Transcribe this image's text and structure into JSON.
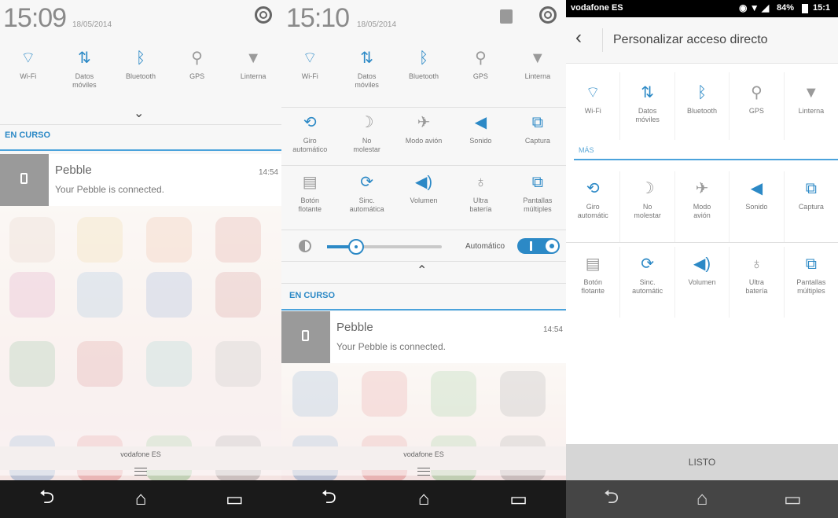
{
  "accent": "#2c89c6",
  "icons_map": {
    "wifi": "wifi-icon",
    "data": "mobile-data-icon",
    "bluetooth": "bluetooth-icon",
    "gps": "gps-icon",
    "torch": "flashlight-icon"
  },
  "screen1": {
    "time": "15:09",
    "date": "18/05/2014",
    "toggles": [
      {
        "label": "Wi-Fi",
        "icon": "wifi-icon"
      },
      {
        "label": "Datos\nmóviles",
        "icon": "mobile-data-icon"
      },
      {
        "label": "Bluetooth",
        "icon": "bluetooth-icon"
      },
      {
        "label": "GPS",
        "icon": "gps-icon"
      },
      {
        "label": "Linterna",
        "icon": "flashlight-icon"
      }
    ],
    "section": "EN CURSO",
    "notification": {
      "title": "Pebble",
      "body": "Your Pebble is connected.",
      "time": "14:54"
    },
    "carrier": "vodafone ES"
  },
  "screen2": {
    "time": "15:10",
    "date": "18/05/2014",
    "row1": [
      {
        "label": "Wi-Fi",
        "icon": "wifi-icon"
      },
      {
        "label": "Datos\nmóviles",
        "icon": "mobile-data-icon"
      },
      {
        "label": "Bluetooth",
        "icon": "bluetooth-icon"
      },
      {
        "label": "GPS",
        "icon": "gps-icon"
      },
      {
        "label": "Linterna",
        "icon": "flashlight-icon"
      }
    ],
    "row2": [
      {
        "label": "Giro\nautomático",
        "icon": "rotate-icon"
      },
      {
        "label": "No\nmolestar",
        "icon": "moon-icon"
      },
      {
        "label": "Modo avión",
        "icon": "airplane-icon"
      },
      {
        "label": "Sonido",
        "icon": "sound-icon"
      },
      {
        "label": "Captura",
        "icon": "screenshot-icon"
      }
    ],
    "row3": [
      {
        "label": "Botón\nflotante",
        "icon": "floating-button-icon"
      },
      {
        "label": "Sinc.\nautomática",
        "icon": "sync-icon"
      },
      {
        "label": "Volumen",
        "icon": "volume-icon"
      },
      {
        "label": "Ultra\nbatería",
        "icon": "bulb-icon"
      },
      {
        "label": "Pantallas\nmúltiples",
        "icon": "multi-screen-icon"
      }
    ],
    "brightness_level": 0.25,
    "auto_label": "Automático",
    "section": "EN CURSO",
    "notification": {
      "title": "Pebble",
      "body": "Your Pebble is connected.",
      "time": "14:54"
    },
    "carrier": "vodafone ES"
  },
  "screen3": {
    "carrier": "vodafone ES",
    "battery": "84%",
    "clock": "15:1",
    "title": "Personalizar acceso directo",
    "row1": [
      {
        "label": "Wi-Fi",
        "icon": "wifi-icon"
      },
      {
        "label": "Datos\nmóviles",
        "icon": "mobile-data-icon"
      },
      {
        "label": "Bluetooth",
        "icon": "bluetooth-icon"
      },
      {
        "label": "GPS",
        "icon": "gps-icon"
      },
      {
        "label": "Linterna",
        "icon": "flashlight-icon"
      }
    ],
    "more_label": "MÁS",
    "row2": [
      {
        "label": "Giro\nautomátic",
        "icon": "rotate-icon"
      },
      {
        "label": "No\nmolestar",
        "icon": "moon-icon"
      },
      {
        "label": "Modo\navión",
        "icon": "airplane-icon"
      },
      {
        "label": "Sonido",
        "icon": "sound-icon"
      },
      {
        "label": "Captura",
        "icon": "screenshot-icon"
      }
    ],
    "row3": [
      {
        "label": "Botón\nflotante",
        "icon": "floating-button-icon"
      },
      {
        "label": "Sinc.\nautomátic",
        "icon": "sync-icon"
      },
      {
        "label": "Volumen",
        "icon": "volume-icon"
      },
      {
        "label": "Ultra\nbatería",
        "icon": "bulb-icon"
      },
      {
        "label": "Pantallas\nmúltiples",
        "icon": "multi-screen-icon"
      }
    ],
    "done": "LISTO"
  }
}
